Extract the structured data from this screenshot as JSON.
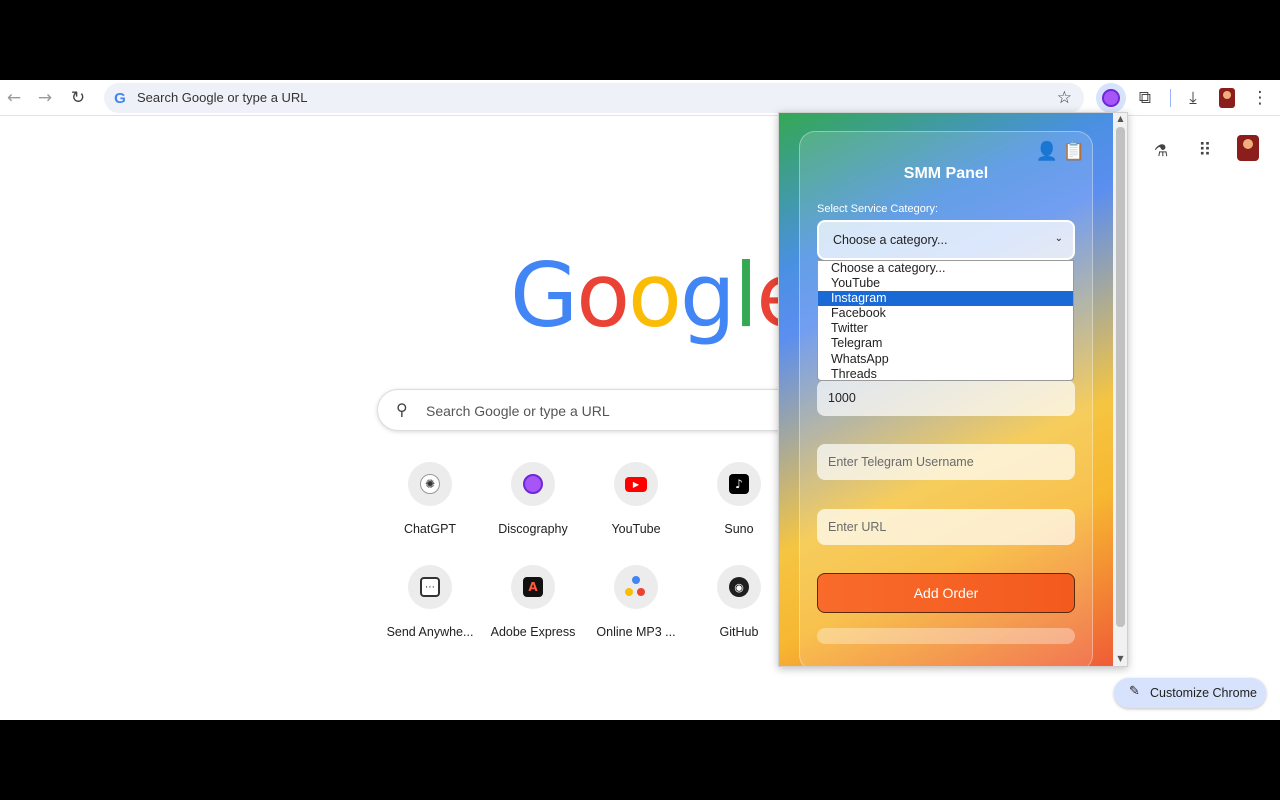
{
  "browser": {
    "omnibox_placeholder": "Search Google or type a URL"
  },
  "ntp": {
    "logo_text": [
      "G",
      "o",
      "o",
      "g",
      "l",
      "e"
    ],
    "logo_colors": [
      "#4285f4",
      "#ea4335",
      "#fbbc05",
      "#4285f4",
      "#34a853",
      "#ea4335"
    ],
    "search_placeholder": "Search Google or type a URL",
    "shortcuts": [
      {
        "label": "ChatGPT",
        "icon": "chatgpt-icon"
      },
      {
        "label": "Discography",
        "icon": "discography-icon"
      },
      {
        "label": "YouTube",
        "icon": "youtube-icon"
      },
      {
        "label": "Suno",
        "icon": "suno-icon"
      },
      {
        "label": "Send Anywhe...",
        "icon": "send-anywhere-icon"
      },
      {
        "label": "Adobe Express",
        "icon": "adobe-express-icon"
      },
      {
        "label": "Online MP3 ...",
        "icon": "online-mp3-icon"
      },
      {
        "label": "GitHub",
        "icon": "github-icon"
      }
    ],
    "customize_label": "Customize Chrome"
  },
  "popup": {
    "title": "SMM Panel",
    "category_label": "Select Service Category:",
    "category_selected": "Choose a category...",
    "category_options": [
      "Choose a category...",
      "YouTube",
      "Instagram",
      "Facebook",
      "Twitter",
      "Telegram",
      "WhatsApp",
      "Threads"
    ],
    "highlighted_option": "Instagram",
    "quantity_value": "1000",
    "username_placeholder": "Enter Telegram Username",
    "url_placeholder": "Enter URL",
    "add_order_label": "Add Order"
  }
}
